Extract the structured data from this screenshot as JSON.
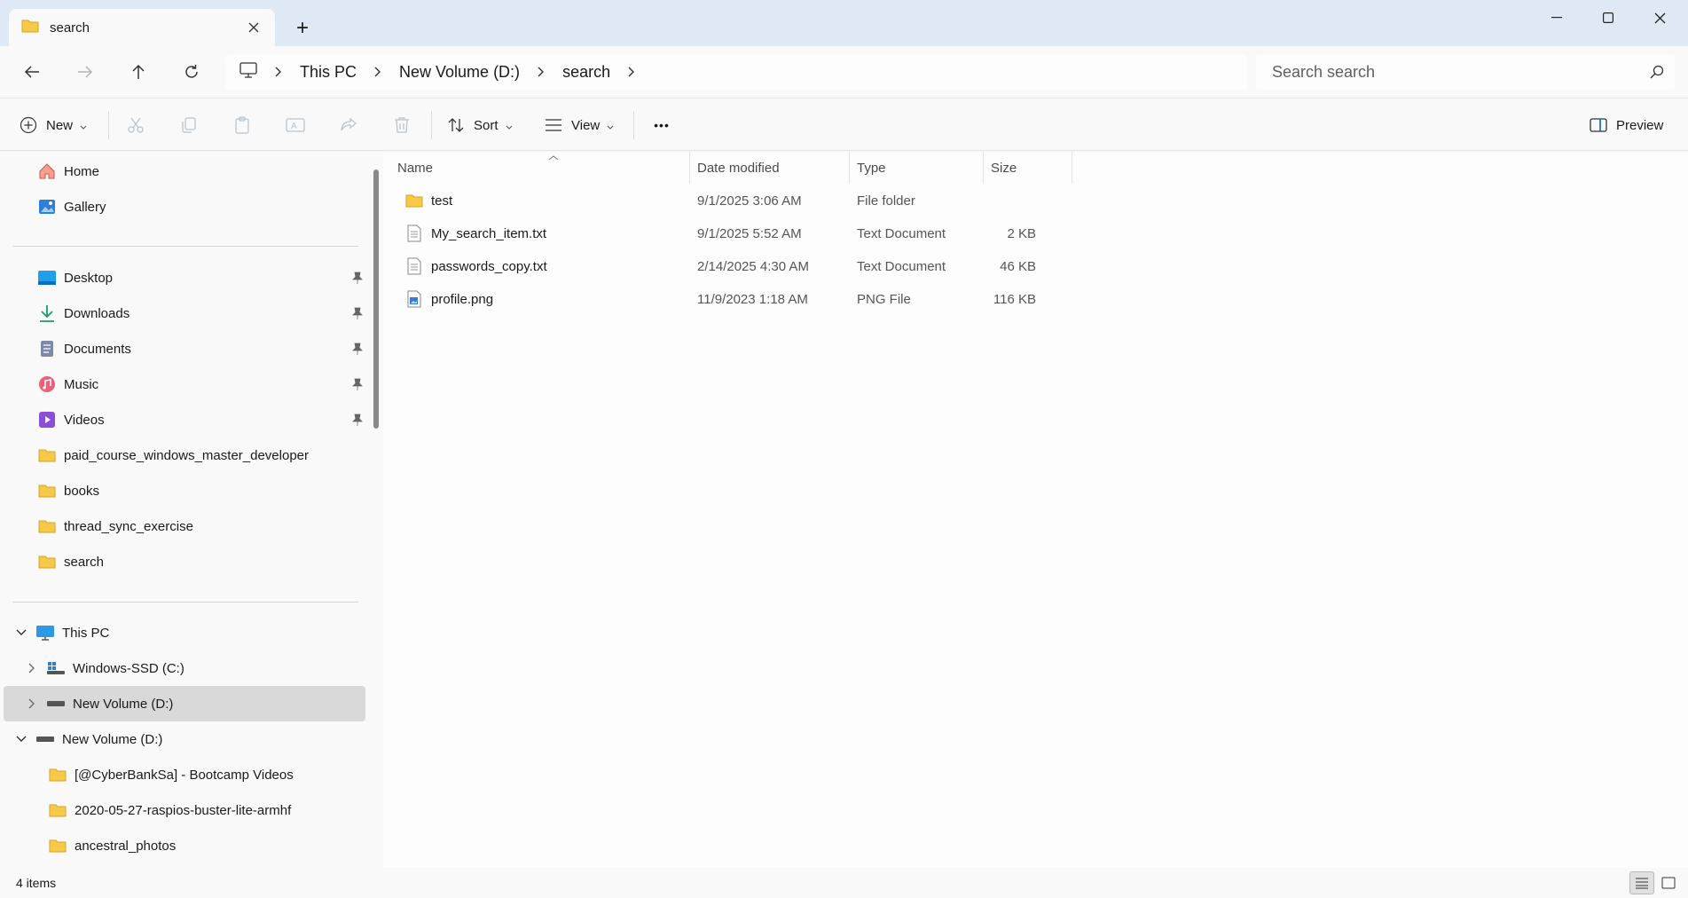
{
  "window": {
    "tab_title": "search",
    "new_tab_symbol": "+",
    "tab_icon": "folder-icon"
  },
  "address_bar": {
    "breadcrumbs": [
      "This PC",
      "New Volume (D:)",
      "search"
    ],
    "search_placeholder": "Search search"
  },
  "command_bar": {
    "new_label": "New",
    "sort_label": "Sort",
    "view_label": "View",
    "more_label": "•••",
    "preview_label": "Preview"
  },
  "nav_pane": {
    "top_items": [
      {
        "label": "Home",
        "icon": "home-icon"
      },
      {
        "label": "Gallery",
        "icon": "gallery-icon"
      }
    ],
    "quick_access": [
      {
        "label": "Desktop",
        "icon": "desktop-icon",
        "pinned": true
      },
      {
        "label": "Downloads",
        "icon": "download-icon",
        "pinned": true
      },
      {
        "label": "Documents",
        "icon": "documents-icon",
        "pinned": true
      },
      {
        "label": "Music",
        "icon": "music-icon",
        "pinned": true
      },
      {
        "label": "Videos",
        "icon": "videos-icon",
        "pinned": true
      },
      {
        "label": "paid_course_windows_master_developer",
        "icon": "folder-icon"
      },
      {
        "label": "books",
        "icon": "folder-icon"
      },
      {
        "label": "thread_sync_exercise",
        "icon": "folder-icon"
      },
      {
        "label": "search",
        "icon": "folder-icon"
      }
    ],
    "this_pc": {
      "label": "This PC",
      "icon": "computer-icon"
    },
    "drives": [
      {
        "label": "Windows-SSD (C:)",
        "icon": "windows-drive-icon"
      },
      {
        "label": "New Volume (D:)",
        "icon": "drive-icon",
        "selected": true
      }
    ],
    "d_drive": {
      "label": "New Volume (D:)",
      "icon": "drive-icon"
    },
    "d_children": [
      {
        "label": "[@CyberBankSa] - Bootcamp Videos",
        "icon": "folder-icon"
      },
      {
        "label": "2020-05-27-raspios-buster-lite-armhf",
        "icon": "folder-icon"
      },
      {
        "label": "ancestral_photos",
        "icon": "folder-icon"
      }
    ]
  },
  "file_list": {
    "columns": {
      "name": "Name",
      "date": "Date modified",
      "type": "Type",
      "size": "Size"
    },
    "rows": [
      {
        "name": "test",
        "date": "9/1/2025 3:06 AM",
        "type": "File folder",
        "size": "",
        "icon": "folder-icon"
      },
      {
        "name": "My_search_item.txt",
        "date": "9/1/2025 5:52 AM",
        "type": "Text Document",
        "size": "2 KB",
        "icon": "text-file-icon"
      },
      {
        "name": "passwords_copy.txt",
        "date": "2/14/2025 4:30 AM",
        "type": "Text Document",
        "size": "46 KB",
        "icon": "text-file-icon"
      },
      {
        "name": "profile.png",
        "date": "11/9/2023 1:18 AM",
        "type": "PNG File",
        "size": "116 KB",
        "icon": "image-file-icon"
      }
    ]
  },
  "status_bar": {
    "item_count": "4 items"
  },
  "colors": {
    "title_bar": "#dfe9f5",
    "folder": "#f7c948",
    "accent": "#0067c0",
    "selected": "#d9d9d9"
  }
}
